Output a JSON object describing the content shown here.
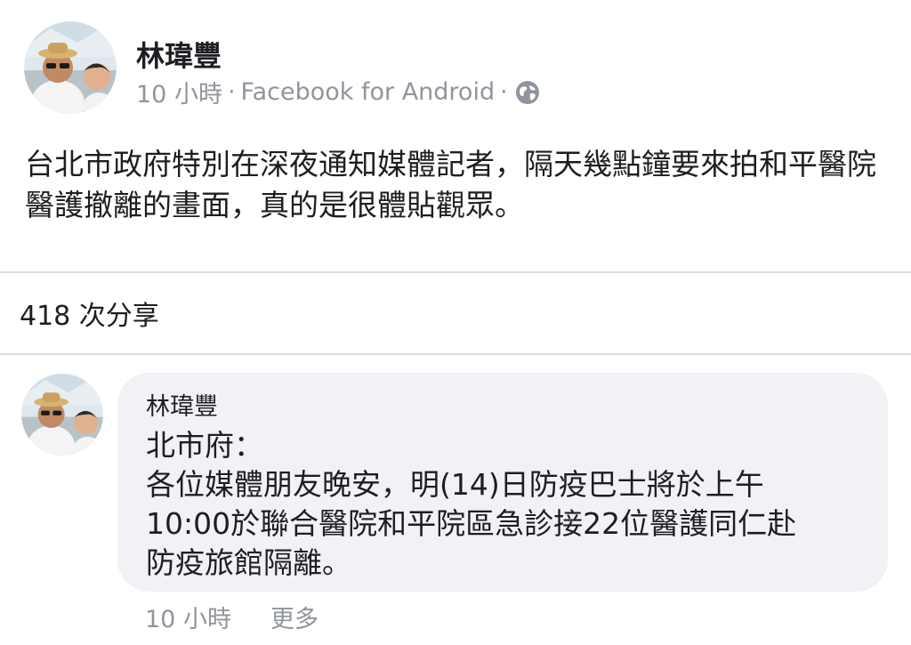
{
  "post": {
    "author": "林瑋豐",
    "time": "10 小時",
    "separator": "·",
    "source": "Facebook for Android",
    "visibility_icon": "globe-icon",
    "text": "台北市政府特別在深夜通知媒體記者，隔天幾點鐘要來拍和平醫院醫護撤離的畫面，真的是很體貼觀眾。",
    "shares": "418 次分享"
  },
  "comment": {
    "author": "林瑋豐",
    "lines": [
      "北市府：",
      "各位媒體朋友晚安，明(14)日防疫巴士將於上午",
      "10:00於聯合醫院和平院區急診接22位醫護同仁赴",
      "防疫旅館隔離。"
    ],
    "time": "10 小時",
    "more": "更多"
  },
  "colors": {
    "text": "#1c1e21",
    "meta": "#90949c",
    "bubble": "#f0f2f5",
    "divider": "#dadde1"
  }
}
